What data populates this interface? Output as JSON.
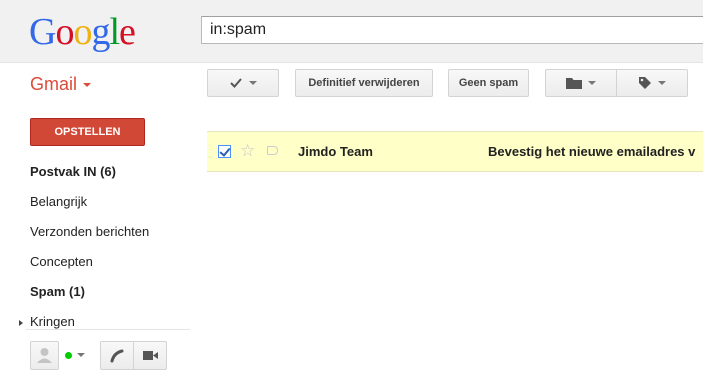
{
  "logo": {
    "letters": [
      "G",
      "o",
      "o",
      "g",
      "l",
      "e"
    ],
    "colors": [
      "#3369e8",
      "#d50f25",
      "#eeb211",
      "#3369e8",
      "#009925",
      "#d50f25"
    ]
  },
  "search": {
    "value": "in:spam"
  },
  "app": {
    "name": "Gmail"
  },
  "toolbar": {
    "select_icon": "checkbox-icon",
    "delete_forever_label": "Definitief verwijderen",
    "not_spam_label": "Geen spam",
    "move_icon": "folder-icon",
    "labels_icon": "tag-icon"
  },
  "compose": {
    "label": "OPSTELLEN"
  },
  "nav": {
    "items": [
      {
        "label": "Postvak IN (6)",
        "bold": true
      },
      {
        "label": "Belangrijk",
        "bold": false
      },
      {
        "label": "Verzonden berichten",
        "bold": false
      },
      {
        "label": "Concepten",
        "bold": false
      },
      {
        "label": "Spam (1)",
        "bold": true
      }
    ],
    "circles_label": "Kringen"
  },
  "chat": {
    "status_color": "#0c0",
    "icons": [
      "avatar-icon",
      "status-dot-icon",
      "phone-icon",
      "video-icon"
    ]
  },
  "messages": [
    {
      "checked": true,
      "starred": false,
      "sender": "Jimdo Team",
      "subject": "Bevestig het nieuwe emailadres v"
    }
  ],
  "colors": {
    "accent": "#dd4b39",
    "compose_bg": "#d14836",
    "selected_row": "#ffffc8"
  }
}
